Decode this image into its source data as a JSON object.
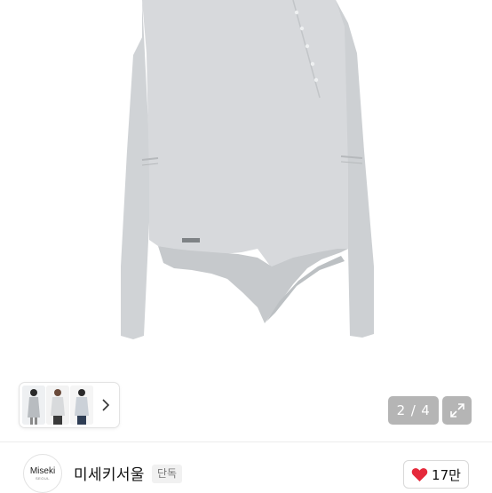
{
  "product_image": {
    "icon": "product-photo-grey-asymmetric-top"
  },
  "thumbnail_strip": {
    "arrow_icon": "chevron-right-icon"
  },
  "pager": {
    "current": "2",
    "separator": "/",
    "total": "4"
  },
  "expand": {
    "icon": "expand-diagonal-icon"
  },
  "brand": {
    "logo_text": "Miseki",
    "logo_subtext": "SEOUL",
    "name": "미세키서울",
    "tag": "단독"
  },
  "like": {
    "icon": "heart-icon",
    "color": "#e5293b",
    "count": "17만"
  }
}
